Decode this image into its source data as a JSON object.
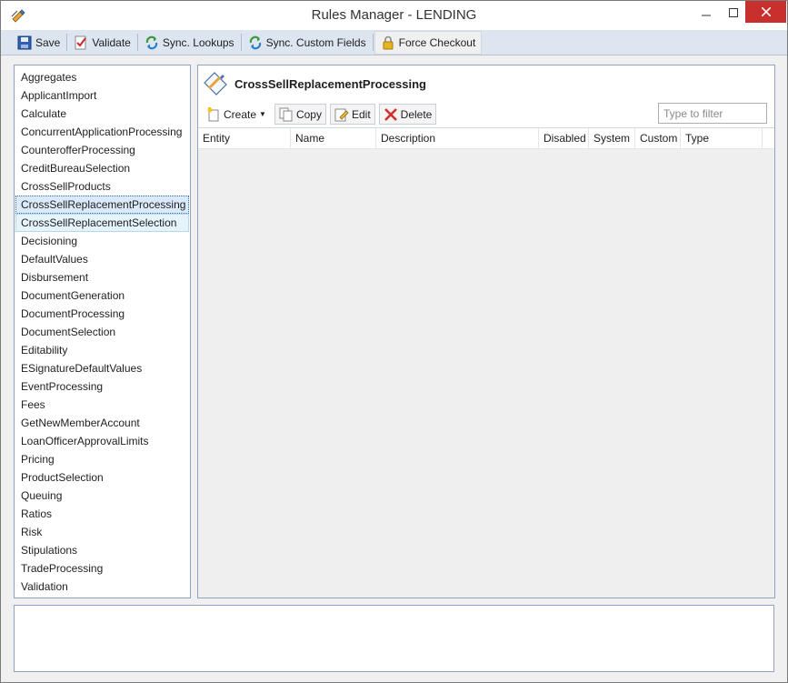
{
  "window": {
    "title": "Rules Manager - LENDING",
    "icon": "rules-manager-app-icon",
    "controls": [
      "minimize",
      "maximize",
      "close"
    ]
  },
  "toolbar": {
    "buttons": [
      {
        "label": "Save",
        "icon": "floppy-disk-icon"
      },
      {
        "label": "Validate",
        "icon": "validate-check-icon"
      },
      {
        "label": "Sync. Lookups",
        "icon": "sync-icon"
      },
      {
        "label": "Sync. Custom Fields",
        "icon": "sync-icon"
      },
      {
        "label": "Force Checkout",
        "icon": "padlock-icon"
      }
    ]
  },
  "sidebar": {
    "items": [
      "Aggregates",
      "ApplicantImport",
      "Calculate",
      "ConcurrentApplicationProcessing",
      "CounterofferProcessing",
      "CreditBureauSelection",
      "CrossSellProducts",
      "CrossSellReplacementProcessing",
      "CrossSellReplacementSelection",
      "Decisioning",
      "DefaultValues",
      "Disbursement",
      "DocumentGeneration",
      "DocumentProcessing",
      "DocumentSelection",
      "Editability",
      "ESignatureDefaultValues",
      "EventProcessing",
      "Fees",
      "GetNewMemberAccount",
      "LoanOfficerApprovalLimits",
      "Pricing",
      "ProductSelection",
      "Queuing",
      "Ratios",
      "Risk",
      "Stipulations",
      "TradeProcessing",
      "Validation"
    ],
    "selected_index": 7,
    "hover_index": 8
  },
  "main": {
    "title": "CrossSellReplacementProcessing",
    "actions": {
      "create": "Create",
      "copy": "Copy",
      "edit": "Edit",
      "delete": "Delete"
    },
    "filter": {
      "placeholder": "Type to filter",
      "value": ""
    },
    "grid": {
      "columns": [
        "Entity",
        "Name",
        "Description",
        "Disabled",
        "System",
        "Custom",
        "Type"
      ],
      "rows": []
    }
  },
  "colors": {
    "toolbar_bg": "#dde5f0",
    "close_button": "#c7302c",
    "selection_bg": "#dbeafa",
    "border_accent": "#8da3c1"
  }
}
